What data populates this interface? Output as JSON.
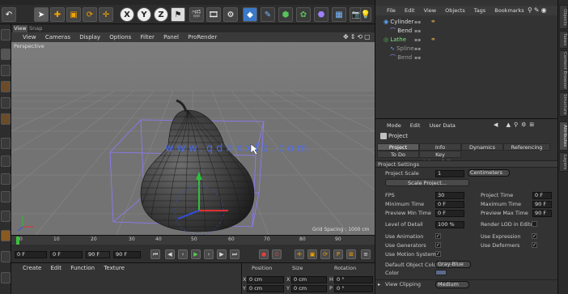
{
  "top_toolbar": {
    "icons": [
      "undo-icon",
      "select-icon",
      "move-icon",
      "scale-icon",
      "rotate-icon",
      "move-tool-icon",
      "x-axis-icon",
      "y-axis-icon",
      "z-axis-icon",
      "coordinate-icon",
      "render-view-icon",
      "render-picture-icon",
      "render-settings-icon",
      "cube-icon",
      "pen-icon",
      "subdivision-icon",
      "array-icon",
      "deformer-icon",
      "scene-icon",
      "camera-icon",
      "light-icon"
    ],
    "axis_labels": [
      "X",
      "Y",
      "Z"
    ]
  },
  "viewport": {
    "tabs": [
      "View",
      "Snap"
    ],
    "menu": [
      "View",
      "Cameras",
      "Display",
      "Options",
      "Filter",
      "Panel",
      "ProRender"
    ],
    "name": "Perspective",
    "grid_spacing": "Grid Spacing : 1000 cm",
    "watermark": "www.qdnxxfb.com"
  },
  "timeline": {
    "ticks": [
      "0",
      "10",
      "20",
      "30",
      "40",
      "50",
      "60",
      "70",
      "80",
      "90"
    ],
    "current": "0 F",
    "start": "0 F",
    "end": "90 F",
    "end2": "90 F"
  },
  "material_menu": [
    "Create",
    "Edit",
    "Function",
    "Texture"
  ],
  "coordinates": {
    "headers": [
      "Position",
      "Size",
      "Rotation"
    ],
    "rows": [
      {
        "axis": "X",
        "pos": "0 cm",
        "size": "0 cm",
        "rot_axis": "H",
        "rot": "0 °"
      },
      {
        "axis": "Y",
        "pos": "0 cm",
        "size": "0 cm",
        "rot_axis": "P",
        "rot": "0 °"
      }
    ]
  },
  "object_manager": {
    "menu": [
      "File",
      "Edit",
      "View",
      "Objects",
      "Tags",
      "Bookmarks"
    ],
    "items": [
      {
        "name": "Cylinder",
        "indent": 0
      },
      {
        "name": "Bend",
        "indent": 1
      },
      {
        "name": "Lathe",
        "indent": 0
      },
      {
        "name": "Spline",
        "indent": 1
      },
      {
        "name": "Bend",
        "indent": 1
      }
    ]
  },
  "attribute_manager": {
    "menu": [
      "Mode",
      "Edit",
      "User Data"
    ],
    "title": "Project",
    "tabs_row1": [
      "Project Settings",
      "Info",
      "Dynamics",
      "Referencing"
    ],
    "tabs_row2": [
      "To Do",
      "Key Interpolation"
    ],
    "section": "Project Settings",
    "project_scale_label": "Project Scale",
    "project_scale_value": "1",
    "project_scale_unit": "Centimeters",
    "scale_button": "Scale Project...",
    "fields_left": [
      {
        "label": "FPS",
        "value": "30"
      },
      {
        "label": "Minimum Time",
        "value": "0 F"
      },
      {
        "label": "Preview Min Time",
        "value": "0 F"
      }
    ],
    "fields_right": [
      {
        "label": "Project Time",
        "value": "0 F"
      },
      {
        "label": "Maximum Time",
        "value": "90 F"
      },
      {
        "label": "Preview Max Time",
        "value": "90 F"
      }
    ],
    "lod_label": "Level of Detail",
    "lod_value": "100 %",
    "render_lod_label": "Render LOD in Editor",
    "checks_left": [
      "Use Animation",
      "Use Generators",
      "Use Motion System"
    ],
    "checks_right": [
      "Use Expression",
      "Use Deformers"
    ],
    "default_color_label": "Default Object Color",
    "default_color_value": "Gray-Blue",
    "color_label": "Color",
    "view_clipping_label": "View Clipping",
    "view_clipping_value": "Medium"
  },
  "side_tabs": [
    "Objects",
    "Takes",
    "Content Browser",
    "Structure",
    "Attributes",
    "Layers"
  ]
}
